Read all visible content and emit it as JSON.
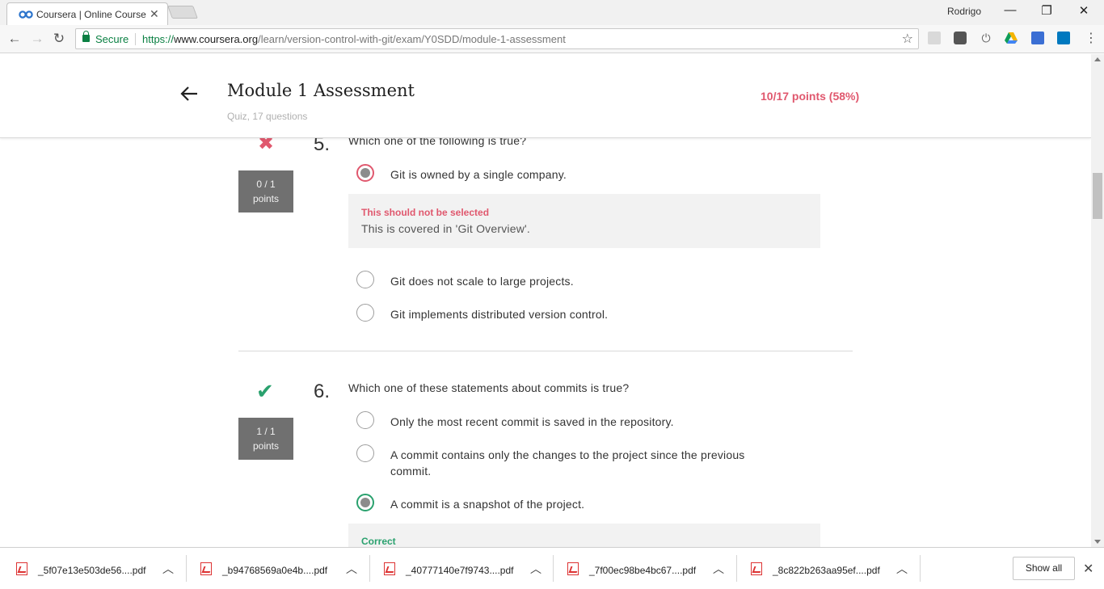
{
  "browser": {
    "tab_title": "Coursera | Online Course",
    "user_name": "Rodrigo",
    "secure_label": "Secure",
    "url_scheme": "https://",
    "url_host": "www.coursera.org",
    "url_path": "/learn/version-control-with-git/exam/Y0SDD/module-1-assessment",
    "window_buttons": [
      "—",
      "❐",
      "✕"
    ]
  },
  "quiz": {
    "title": "Module 1 Assessment",
    "subtitle": "Quiz, 17 questions",
    "score": "10/17 points (58%)"
  },
  "questions": [
    {
      "number": "5.",
      "text": "Which one of the following is true?",
      "status": "incorrect",
      "points_line1": "0 / 1",
      "points_line2": "points",
      "options": [
        "Git is owned by a single company.",
        "Git does not scale to large projects.",
        "Git implements distributed version control."
      ],
      "feedback_title": "This should not be selected",
      "feedback_text": "This is covered in 'Git Overview'."
    },
    {
      "number": "6.",
      "text": "Which one of these statements about commits is true?",
      "status": "correct",
      "points_line1": "1 / 1",
      "points_line2": "points",
      "options": [
        "Only the most recent commit is saved in the repository.",
        "A commit contains only the changes to the project since the previous commit.",
        "A commit is a snapshot of the project."
      ],
      "feedback_title": "Correct"
    }
  ],
  "colors": {
    "incorrect": "#e0586e",
    "correct": "#2aa16e",
    "points_box": "#707070"
  },
  "downloads": {
    "files": [
      "_5f07e13e503de56....pdf",
      "_b94768569a0e4b....pdf",
      "_40777140e7f9743....pdf",
      "_7f00ec98be4bc67....pdf",
      "_8c822b263aa95ef....pdf"
    ],
    "show_all": "Show all"
  },
  "icons": {
    "extensions": [
      "pdf-icon",
      "keep-icon",
      "power-icon",
      "drive-icon",
      "cast-icon",
      "trello-icon"
    ]
  }
}
